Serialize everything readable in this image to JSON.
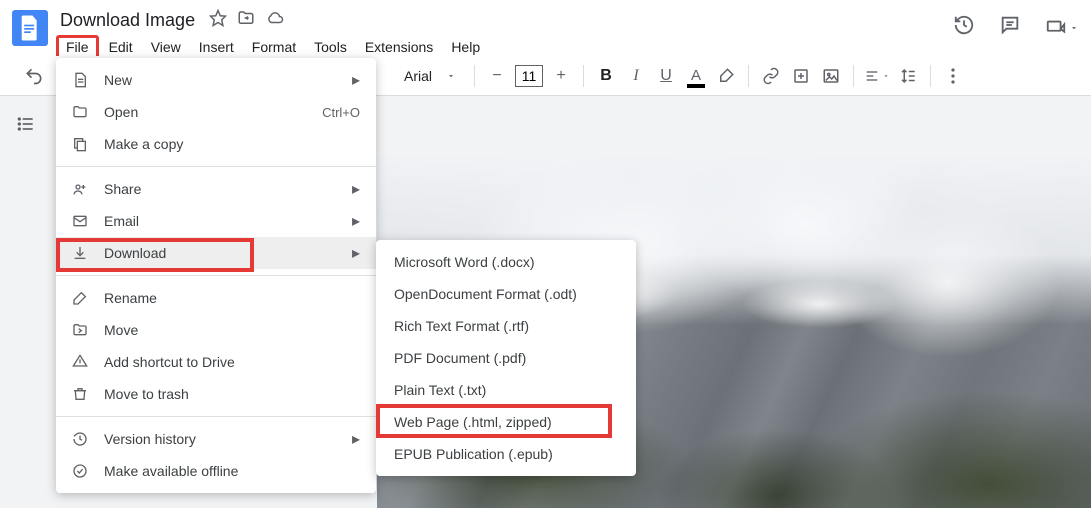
{
  "doc": {
    "title": "Download Image"
  },
  "menubar": {
    "file": "File",
    "edit": "Edit",
    "view": "View",
    "insert": "Insert",
    "format": "Format",
    "tools": "Tools",
    "extensions": "Extensions",
    "help": "Help"
  },
  "toolbar": {
    "font_family": "Arial",
    "font_size": "11"
  },
  "file_menu": {
    "new": "New",
    "open": "Open",
    "open_shortcut": "Ctrl+O",
    "make_copy": "Make a copy",
    "share": "Share",
    "email": "Email",
    "download": "Download",
    "rename": "Rename",
    "move": "Move",
    "add_shortcut": "Add shortcut to Drive",
    "trash": "Move to trash",
    "version_history": "Version history",
    "offline": "Make available offline"
  },
  "download_submenu": {
    "docx": "Microsoft Word (.docx)",
    "odt": "OpenDocument Format (.odt)",
    "rtf": "Rich Text Format (.rtf)",
    "pdf": "PDF Document (.pdf)",
    "txt": "Plain Text (.txt)",
    "html": "Web Page (.html, zipped)",
    "epub": "EPUB Publication (.epub)"
  }
}
